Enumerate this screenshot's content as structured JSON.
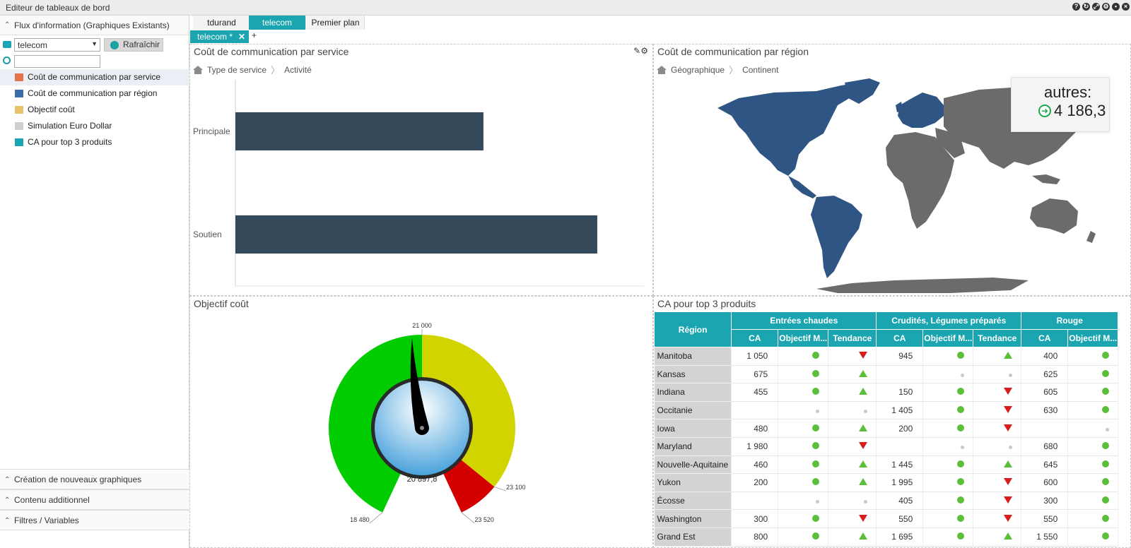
{
  "app": {
    "title": "Editeur de tableaux de bord"
  },
  "sidebar": {
    "section_title": "Flux d'information (Graphiques Existants)",
    "feed_select": "telecom",
    "refresh_label": "Rafraîchir",
    "search_placeholder": "",
    "items": [
      {
        "label": "Coût de communication par service",
        "icon": "bar-chart-icon",
        "selected": true
      },
      {
        "label": "Coût de communication par région",
        "icon": "map-chart-icon",
        "selected": false
      },
      {
        "label": "Objectif coût",
        "icon": "gauge-icon",
        "selected": false
      },
      {
        "label": "Simulation Euro Dollar",
        "icon": "line-chart-icon",
        "selected": false
      },
      {
        "label": "CA pour top 3 produits",
        "icon": "table-icon",
        "selected": false
      }
    ],
    "bottom_sections": [
      "Création de nouveaux graphiques",
      "Contenu additionnel",
      "Filtres / Variables"
    ]
  },
  "tabs": {
    "top": [
      {
        "label": "tdurand",
        "active": false
      },
      {
        "label": "telecom",
        "active": true
      },
      {
        "label": "Premier plan",
        "active": false
      }
    ],
    "dashboard_tab": "telecom *",
    "close": "✕",
    "add": "+"
  },
  "panels": {
    "service": {
      "title": "Coût de communication par service",
      "breadcrumb": [
        "Type de service",
        "Activité"
      ]
    },
    "region": {
      "title": "Coût de communication par région",
      "breadcrumb": [
        "Géographique",
        "Continent"
      ],
      "tooltip_label": "autres:",
      "tooltip_value": "4 186,3",
      "colors": {
        "highlight": "#2e5583",
        "other": "#6b6b6b"
      }
    },
    "gauge": {
      "title": "Objectif coût",
      "value_text": "20 897,8",
      "value": 20897.8,
      "min": 18480,
      "max": 23520,
      "labels": {
        "top": "21 000",
        "right": "23 100",
        "bottom_right": "23 520",
        "bottom_left": "18 480"
      },
      "bands": [
        {
          "from": 18480,
          "to": 21000,
          "color": "#00cc00"
        },
        {
          "from": 21000,
          "to": 23100,
          "color": "#d2d400"
        },
        {
          "from": 23100,
          "to": 23520,
          "color": "#d40000"
        }
      ]
    },
    "table": {
      "title": "CA pour top 3 produits",
      "region_header": "Région",
      "groups": [
        "Entrées chaudes",
        "Crudités, Légumes préparés",
        "Rouge"
      ],
      "subheaders": [
        "CA",
        "Objectif M...",
        "Tendance",
        "CA",
        "Objectif M...",
        "Tendance",
        "CA",
        "Objectif M..."
      ],
      "rows": [
        {
          "region": "Manitoba",
          "c": [
            [
              "1 050",
              "g",
              "down"
            ],
            [
              "945",
              "g",
              "up"
            ],
            [
              "400",
              "g"
            ]
          ]
        },
        {
          "region": "Kansas",
          "c": [
            [
              "675",
              "g",
              "up"
            ],
            [
              "",
              "s",
              "s"
            ],
            [
              "625",
              "g"
            ]
          ]
        },
        {
          "region": "Indiana",
          "c": [
            [
              "455",
              "g",
              "up"
            ],
            [
              "150",
              "g",
              "down"
            ],
            [
              "605",
              "g"
            ]
          ]
        },
        {
          "region": "Occitanie",
          "c": [
            [
              "",
              "s",
              "s"
            ],
            [
              "1 405",
              "g",
              "down"
            ],
            [
              "630",
              "g"
            ]
          ]
        },
        {
          "region": "Iowa",
          "c": [
            [
              "480",
              "g",
              "up"
            ],
            [
              "200",
              "g",
              "down"
            ],
            [
              "",
              "s"
            ]
          ]
        },
        {
          "region": "Maryland",
          "c": [
            [
              "1 980",
              "g",
              "down"
            ],
            [
              "",
              "s",
              "s"
            ],
            [
              "680",
              "g"
            ]
          ]
        },
        {
          "region": "Nouvelle-Aquitaine",
          "c": [
            [
              "460",
              "g",
              "up"
            ],
            [
              "1 445",
              "g",
              "up"
            ],
            [
              "645",
              "g"
            ]
          ]
        },
        {
          "region": "Yukon",
          "c": [
            [
              "200",
              "g",
              "up"
            ],
            [
              "1 995",
              "g",
              "down"
            ],
            [
              "600",
              "g"
            ]
          ]
        },
        {
          "region": "Écosse",
          "c": [
            [
              "",
              "s",
              "s"
            ],
            [
              "405",
              "g",
              "down"
            ],
            [
              "300",
              "g"
            ]
          ]
        },
        {
          "region": "Washington",
          "c": [
            [
              "300",
              "g",
              "down"
            ],
            [
              "550",
              "g",
              "down"
            ],
            [
              "550",
              "g"
            ]
          ]
        },
        {
          "region": "Grand Est",
          "c": [
            [
              "800",
              "g",
              "up"
            ],
            [
              "1 695",
              "g",
              "up"
            ],
            [
              "1 550",
              "g"
            ]
          ]
        }
      ]
    }
  },
  "chart_data": {
    "type": "bar",
    "orientation": "horizontal",
    "categories": [
      "Principale",
      "Soutien"
    ],
    "values": [
      8500,
      12400
    ],
    "xlim": [
      0,
      14000
    ],
    "xticks": [
      "0",
      "2 000",
      "4 000",
      "6 000",
      "8 000",
      "10 000",
      "12 000",
      "14 000"
    ],
    "bar_color": "#344a5b",
    "grid": false
  }
}
